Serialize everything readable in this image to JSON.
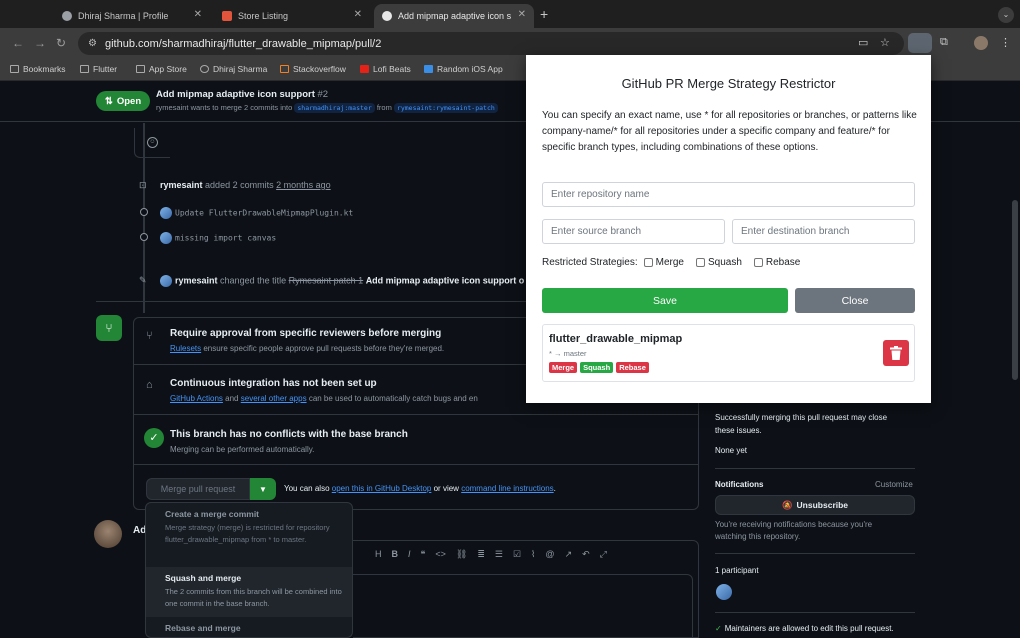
{
  "browser": {
    "tabs": [
      {
        "title": "Dhiraj Sharma | Profile"
      },
      {
        "title": "Store Listing"
      },
      {
        "title": "Add mipmap adaptive icon s"
      }
    ],
    "url": "github.com/sharmadhiraj/flutter_drawable_mipmap/pull/2",
    "bookmarks": [
      "Bookmarks",
      "Flutter",
      "App Store",
      "Dhiraj Sharma",
      "Stackoverflow",
      "Lofi Beats",
      "Random iOS App"
    ]
  },
  "pr": {
    "status": "Open",
    "title": "Add mipmap adaptive icon support",
    "number": "#2",
    "subtitle_prefix": "rymesaint wants to merge 2 commits into",
    "base_branch": "sharmadhiraj:master",
    "from_word": "from",
    "head_branch": "rymesaint:rymesaint-patch"
  },
  "timeline": {
    "commits_event": {
      "user": "rymesaint",
      "action": "added 2 commits",
      "time": "2 months ago"
    },
    "commits": [
      "Update FlutterDrawableMipmapPlugin.kt",
      "missing import canvas"
    ],
    "title_event": {
      "user": "rymesaint",
      "action": "changed the title",
      "old_title": "Rymesaint patch 1",
      "new_title": "Add mipmap adaptive icon support o"
    }
  },
  "merge_box": {
    "review": {
      "title": "Require approval from specific reviewers before merging",
      "link": "Rulesets",
      "desc": "ensure specific people approve pull requests before they're merged."
    },
    "ci": {
      "title": "Continuous integration has not been set up",
      "link1": "GitHub Actions",
      "mid": "and",
      "link2": "several other apps",
      "desc": "can be used to automatically catch bugs and en"
    },
    "conflicts": {
      "title": "This branch has no conflicts with the base branch",
      "desc": "Merging can be performed automatically."
    },
    "merge_button": "Merge pull request",
    "hint_prefix": "You can also",
    "hint_link1": "open this in GitHub Desktop",
    "hint_mid": "or view",
    "hint_link2": "command line instructions",
    "hint_suffix": "."
  },
  "merge_dropdown": [
    {
      "title": "Create a merge commit",
      "desc": "Merge strategy (merge) is restricted for repository flutter_drawable_mipmap from * to master."
    },
    {
      "title": "Squash and merge",
      "desc": "The 2 commits from this branch will be combined into one commit in the base branch."
    },
    {
      "title": "Rebase and merge",
      "desc": ""
    }
  ],
  "comment": {
    "add_label": "Ad"
  },
  "sidebar": {
    "issues_text1": "Successfully merging this pull request may close",
    "issues_text2": "these issues.",
    "none_yet": "None yet",
    "notifications": "Notifications",
    "customize": "Customize",
    "unsubscribe": "Unsubscribe",
    "notif_desc1": "You're receiving notifications because you're",
    "notif_desc2": "watching this repository.",
    "participants": "1 participant",
    "maintainers": "Maintainers are allowed to edit this pull request."
  },
  "popup": {
    "title": "GitHub PR Merge Strategy Restrictor",
    "description": "You can specify an exact name, use * for all repositories or branches, or patterns like company-name/* for all repositories under a specific company and feature/* for specific branch types, including combinations of these options.",
    "repo_placeholder": "Enter repository name",
    "source_placeholder": "Enter source branch",
    "dest_placeholder": "Enter destination branch",
    "strategies_label": "Restricted Strategies:",
    "strategies": [
      "Merge",
      "Squash",
      "Rebase"
    ],
    "save": "Save",
    "close": "Close",
    "rule": {
      "repo": "flutter_drawable_mipmap",
      "branches": "* → master",
      "tags": [
        "Merge",
        "Squash",
        "Rebase"
      ]
    }
  },
  "colors": {
    "github_bg": "#0d1117",
    "github_green": "#238636",
    "link_blue": "#4493f8",
    "save_green": "#28a745",
    "close_gray": "#6c757d",
    "danger_red": "#dc3545"
  }
}
